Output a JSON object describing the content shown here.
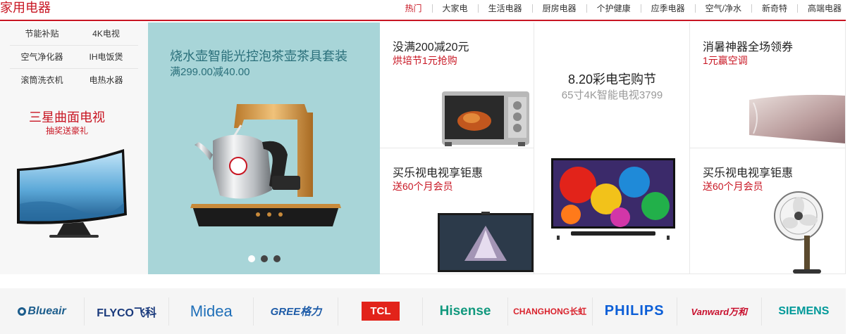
{
  "section": {
    "title": "家用电器"
  },
  "tabs": [
    {
      "label": "热门",
      "active": true
    },
    {
      "label": "大家电"
    },
    {
      "label": "生活电器"
    },
    {
      "label": "厨房电器"
    },
    {
      "label": "个护健康"
    },
    {
      "label": "应季电器"
    },
    {
      "label": "空气/净水"
    },
    {
      "label": "新奇特"
    },
    {
      "label": "高端电器"
    }
  ],
  "categories": [
    {
      "left": "节能补贴",
      "right": "4K电视"
    },
    {
      "left": "空气净化器",
      "right": "IH电饭煲"
    },
    {
      "left": "滚筒洗衣机",
      "right": "电热水器"
    }
  ],
  "left_promo": {
    "title": "三星曲面电视",
    "subtitle": "抽奖送豪礼"
  },
  "carousel": {
    "title": "烧水壶智能光控泡茶壶茶具套装",
    "price": "满299.00减40.00",
    "dot_count": 3,
    "active_dot": 1
  },
  "tiles": {
    "oven": {
      "title": "没满200减20元",
      "subtitle": "烘培节1元抢购"
    },
    "tv_center": {
      "title": "8.20彩电宅购节",
      "subtitle": "65寸4K智能电视3799"
    },
    "aircon": {
      "title": "消暑神器全场领券",
      "subtitle": "1元赢空调"
    },
    "tv_left": {
      "title": "买乐视电视享钜惠",
      "subtitle": "送60个月会员"
    },
    "fan": {
      "title": "买乐视电视享钜惠",
      "subtitle": "送60个月会员"
    }
  },
  "brands": [
    {
      "name": "Blueair",
      "color": "#1c5d8c"
    },
    {
      "name": "FLYCO飞科",
      "color": "#1a3a7c"
    },
    {
      "name": "Midea",
      "color": "#1f6fb8"
    },
    {
      "name": "GREE格力",
      "color": "#1e5ca8"
    },
    {
      "name": "TCL",
      "color": "#e2231a"
    },
    {
      "name": "Hisense",
      "color": "#12997e"
    },
    {
      "name": "CHANGHONG长虹",
      "color": "#d9232d"
    },
    {
      "name": "PHILIPS",
      "color": "#0b5ed7"
    },
    {
      "name": "Vanward万和",
      "color": "#c8102e"
    },
    {
      "name": "SIEMENS",
      "color": "#009999"
    }
  ]
}
